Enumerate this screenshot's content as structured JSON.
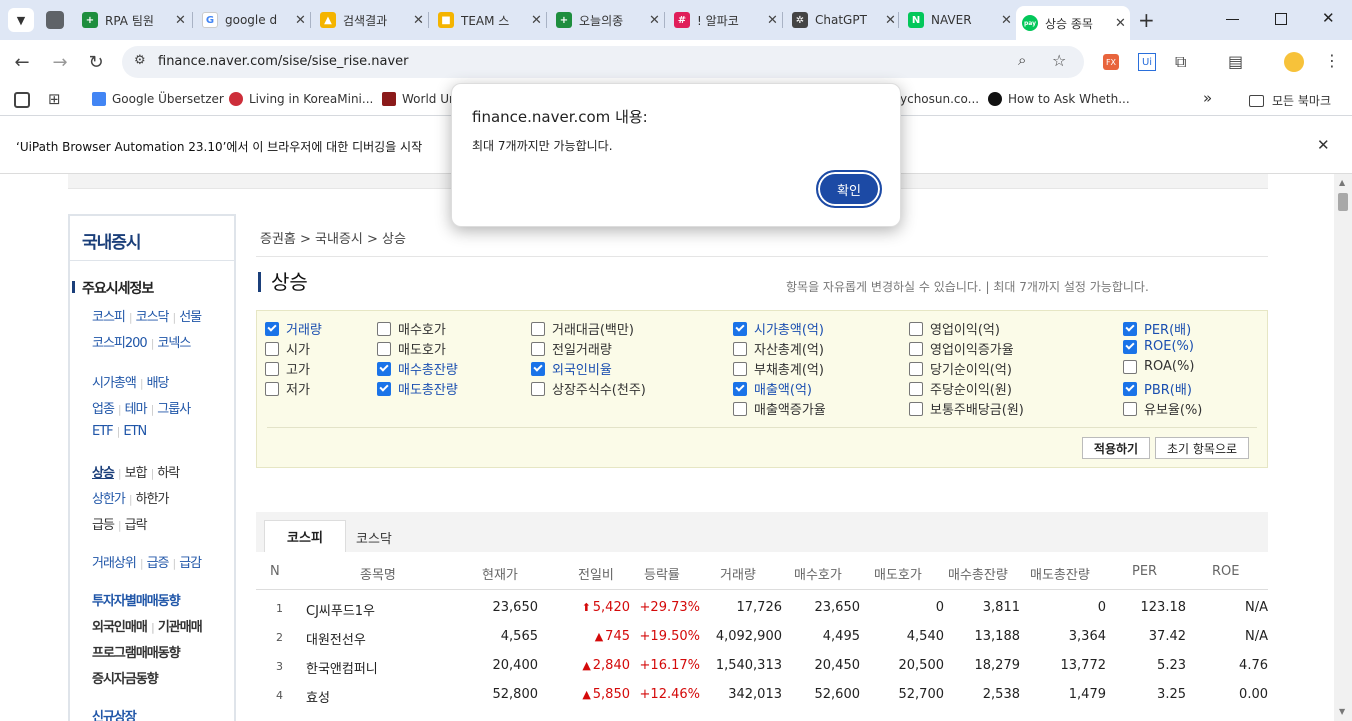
{
  "browser": {
    "tabs": [
      {
        "title": "RPA 팀원",
        "color": "#1e8e3e",
        "glyph": "+"
      },
      {
        "title": "google d",
        "color": "#ffffff",
        "glyph": "G"
      },
      {
        "title": "검색결과",
        "color": "#f4b400",
        "glyph": "▲"
      },
      {
        "title": "TEAM 스",
        "color": "#f4b400",
        "glyph": "■"
      },
      {
        "title": "오늘의종",
        "color": "#1e8e3e",
        "glyph": "+"
      },
      {
        "title": "! 알파코",
        "color": "#e01e5a",
        "glyph": "#"
      },
      {
        "title": "ChatGPT",
        "color": "#444444",
        "glyph": "✲"
      },
      {
        "title": "NAVER",
        "color": "#03c75a",
        "glyph": "N"
      },
      {
        "title": "상승 종목",
        "color": "#03c75a",
        "glyph": "pay"
      }
    ],
    "close_glyph": "✕",
    "new_tab_glyph": "+",
    "url": "finance.naver.com/sise/sise_rise.naver",
    "bookmarks": [
      "Google Übersetzer",
      "Living in KoreaMini...",
      "World Ur",
      "ychosun.co...",
      "How to Ask Wheth..."
    ],
    "bookmark_more": "»",
    "all_bookmarks": "모든 북마크",
    "infobar_text": "‘UiPath Browser Automation 23.10’에서 이 브라우저에 대한 디버깅을 시작",
    "toolbar_icons": {
      "fx": "FX",
      "ui": "Ui"
    }
  },
  "dialog": {
    "title": "finance.naver.com 내용:",
    "message": "최대 7개까지만 가능합니다.",
    "ok_label": "확인"
  },
  "lnb": {
    "title": "국내증시",
    "section": "주요시세정보",
    "rows": [
      [
        "코스피",
        "코스닥",
        "선물"
      ],
      [
        "코스피200",
        "코넥스"
      ],
      [
        "시가총액",
        "배당"
      ],
      [
        "업종",
        "테마",
        "그룹사"
      ],
      [
        "ETF",
        "ETN"
      ],
      [
        "상승",
        "보합",
        "하락"
      ],
      [
        "상한가",
        "하한가"
      ],
      [
        "급등",
        "급락"
      ],
      [
        "거래상위",
        "급증",
        "급감"
      ],
      [
        "투자자별매매동향"
      ],
      [
        "외국인매매",
        "기관매매"
      ],
      [
        "프로그램매매동향"
      ],
      [
        "증시자금동향"
      ],
      [
        "신규상장"
      ]
    ]
  },
  "breadcrumb": "증권홈 > 국내증시 > 상승",
  "page_title": "상승",
  "note": "항목을 자유롭게 변경하실 수 있습니다.   |   최대 7개까지 설정 가능합니다.",
  "options": [
    {
      "label": "거래량",
      "checked": true
    },
    {
      "label": "시가",
      "checked": false
    },
    {
      "label": "고가",
      "checked": false
    },
    {
      "label": "저가",
      "checked": false
    },
    {
      "label": "매수호가",
      "checked": false
    },
    {
      "label": "매도호가",
      "checked": false
    },
    {
      "label": "매수총잔량",
      "checked": true
    },
    {
      "label": "매도총잔량",
      "checked": true
    },
    {
      "label": "거래대금(백만)",
      "checked": false
    },
    {
      "label": "전일거래량",
      "checked": false
    },
    {
      "label": "외국인비율",
      "checked": true
    },
    {
      "label": "상장주식수(천주)",
      "checked": false
    },
    {
      "label": "시가총액(억)",
      "checked": true
    },
    {
      "label": "자산총계(억)",
      "checked": false
    },
    {
      "label": "부채총계(억)",
      "checked": false
    },
    {
      "label": "매출액(억)",
      "checked": true
    },
    {
      "label": "매출액증가율",
      "checked": false
    },
    {
      "label": "영업이익(억)",
      "checked": false
    },
    {
      "label": "영업이익증가율",
      "checked": false
    },
    {
      "label": "당기순이익(억)",
      "checked": false
    },
    {
      "label": "주당순이익(원)",
      "checked": false
    },
    {
      "label": "보통주배당금(원)",
      "checked": false
    },
    {
      "label": "PER(배)",
      "checked": true
    },
    {
      "label": "ROE(%)",
      "checked": true
    },
    {
      "label": "ROA(%)",
      "checked": false
    },
    {
      "label": "PBR(배)",
      "checked": true
    },
    {
      "label": "유보율(%)",
      "checked": false
    }
  ],
  "apply_label": "적용하기",
  "reset_label": "초기 항목으로",
  "market_tabs": [
    "코스피",
    "코스닥"
  ],
  "columns": [
    "N",
    "종목명",
    "현재가",
    "전일비",
    "등락률",
    "거래량",
    "매수호가",
    "매도호가",
    "매수총잔량",
    "매도총잔량",
    "PER",
    "ROE"
  ],
  "rows": [
    {
      "n": "1",
      "name": "CJ씨푸드1우",
      "price": "23,650",
      "arrow": "⬆",
      "change": "5,420",
      "rate": "+29.73%",
      "volume": "17,726",
      "bid": "23,650",
      "ask": "0",
      "bid_total": "3,811",
      "ask_total": "0",
      "per": "123.18",
      "roe": "N/A"
    },
    {
      "n": "2",
      "name": "대원전선우",
      "price": "4,565",
      "arrow": "▲",
      "change": "745",
      "rate": "+19.50%",
      "volume": "4,092,900",
      "bid": "4,495",
      "ask": "4,540",
      "bid_total": "13,188",
      "ask_total": "3,364",
      "per": "37.42",
      "roe": "N/A"
    },
    {
      "n": "3",
      "name": "한국앤컴퍼니",
      "price": "20,400",
      "arrow": "▲",
      "change": "2,840",
      "rate": "+16.17%",
      "volume": "1,540,313",
      "bid": "20,450",
      "ask": "20,500",
      "bid_total": "18,279",
      "ask_total": "13,772",
      "per": "5.23",
      "roe": "4.76"
    },
    {
      "n": "4",
      "name": "효성",
      "price": "52,800",
      "arrow": "▲",
      "change": "5,850",
      "rate": "+12.46%",
      "volume": "342,013",
      "bid": "52,600",
      "ask": "52,700",
      "bid_total": "2,538",
      "ask_total": "1,479",
      "per": "3.25",
      "roe": "0.00"
    }
  ]
}
